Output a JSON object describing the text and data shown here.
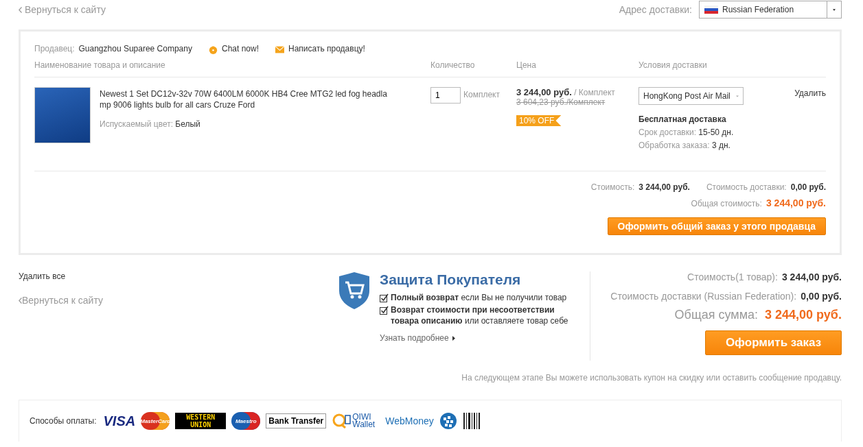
{
  "top_bar": {
    "back_link": "Вернуться к сайту",
    "address_label": "Адрес доставки:",
    "country": "Russian Federation"
  },
  "seller": {
    "label": "Продавец:",
    "name": "Guangzhou Suparee Company",
    "chat": "Chat now!",
    "message": "Написать продавцу!"
  },
  "columns": [
    "Наименование товара и описание",
    "Количество",
    "Цена",
    "Условия доставки"
  ],
  "items": [
    {
      "title": "Newest 1 Set DC12v-32v 70W 6400LM 6000K HB4 Cree MTG2 led fog headla mp 9006 lights bulb for all cars Cruze Ford",
      "color_label": "Испускаемый цвет:",
      "color_value": "Белый",
      "quantity": "1",
      "unit": "Комплект",
      "price": "3 244,00 руб.",
      "price_unit": "/ Комплект",
      "old_price": "3 604,23 руб./Комплект",
      "discount": "10% OFF",
      "shipping_method": "HongKong Post Air Mail",
      "shipping_note": "Бесплатная доставка",
      "delivery_label": "Срок доставки:",
      "delivery_value": "15-50 дн.",
      "processing_label": "Обработка заказа:",
      "processing_value": "3 дн.",
      "delete": "Удалить"
    }
  ],
  "seller_totals": {
    "cost_label": "Стоимость:",
    "cost_value": "3 244,00 руб.",
    "shipping_label": "Стоимость доставки:",
    "shipping_value": "0,00 руб.",
    "total_label": "Общая стоимость:",
    "total_value": "3 244,00 руб.",
    "button": "Оформить общий заказ у этого продавца"
  },
  "bottom_links": {
    "delete_all": "Удалить все",
    "back_link": "Вернуться к сайту"
  },
  "protection": {
    "title": "Защита Покупателя",
    "points": [
      "**Полный возврат** если Вы не получили товар",
      "**Возврат стоимости при несоответствии товара описанию** или оставляете товар себе"
    ],
    "more": "Узнать подробнее"
  },
  "summary": {
    "rows": [
      {
        "label": "Стоимость(1 товар):",
        "value": "3 244,00 руб."
      },
      {
        "label": "Стоимость доставки (Russian Federation):",
        "value": "0,00 руб."
      }
    ],
    "total_label": "Общая сумма:",
    "total_value": "3 244,00 руб.",
    "button": "Оформить заказ",
    "note": "На следующем этапе Вы можете использовать купон на скидку или оставить сообщение продавцу."
  },
  "payments": {
    "label": "Способы оплаты:",
    "methods": [
      {
        "kind": "visa",
        "label": "VISA"
      },
      {
        "kind": "mastercard",
        "label": "MasterCard"
      },
      {
        "kind": "westernunion",
        "label": "WESTERN UNION"
      },
      {
        "kind": "maestro",
        "label": "Maestro"
      },
      {
        "kind": "bank",
        "label": "Bank Transfer"
      },
      {
        "kind": "qiwi",
        "label": "QIWI Wallet"
      },
      {
        "kind": "webmoney",
        "label": "WebMoney"
      },
      {
        "kind": "globe"
      },
      {
        "kind": "barcode"
      }
    ]
  }
}
